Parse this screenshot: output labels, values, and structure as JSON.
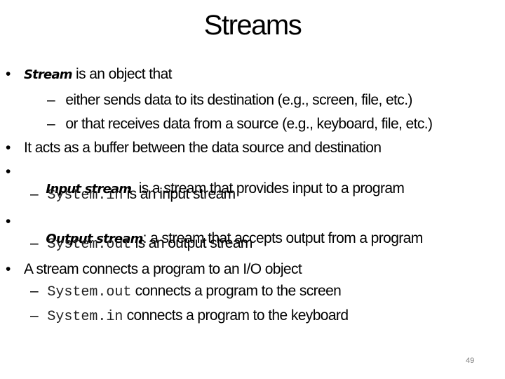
{
  "slide": {
    "title": "Streams",
    "page_number": "49",
    "items": [
      {
        "em": "Stream",
        "text": " is an object that"
      },
      {
        "sub1": "either sends data to its destination (e.g., screen, file, etc.)"
      },
      {
        "sub2": "or that receives data from a source (e.g., keyboard, file, etc.)"
      },
      {
        "text": "It acts as a buffer between the data source and destination"
      },
      {
        "em": "Input stream",
        "text": "  is a stream that provides input to a program"
      },
      {
        "code": "System.in",
        "text": " is an input stream"
      },
      {
        "em": "Output stream",
        "text": ": a stream that accepts output from a program"
      },
      {
        "code": "System.out",
        "text": " is an output stream"
      },
      {
        "text": "A stream connects a program to an I/O object"
      },
      {
        "code": "System.out",
        "text": " connects a program to the screen"
      },
      {
        "code": "System.in",
        "text": " connects a program to the keyboard"
      }
    ],
    "bullet_glyph": "•",
    "dash_glyph": "–"
  }
}
